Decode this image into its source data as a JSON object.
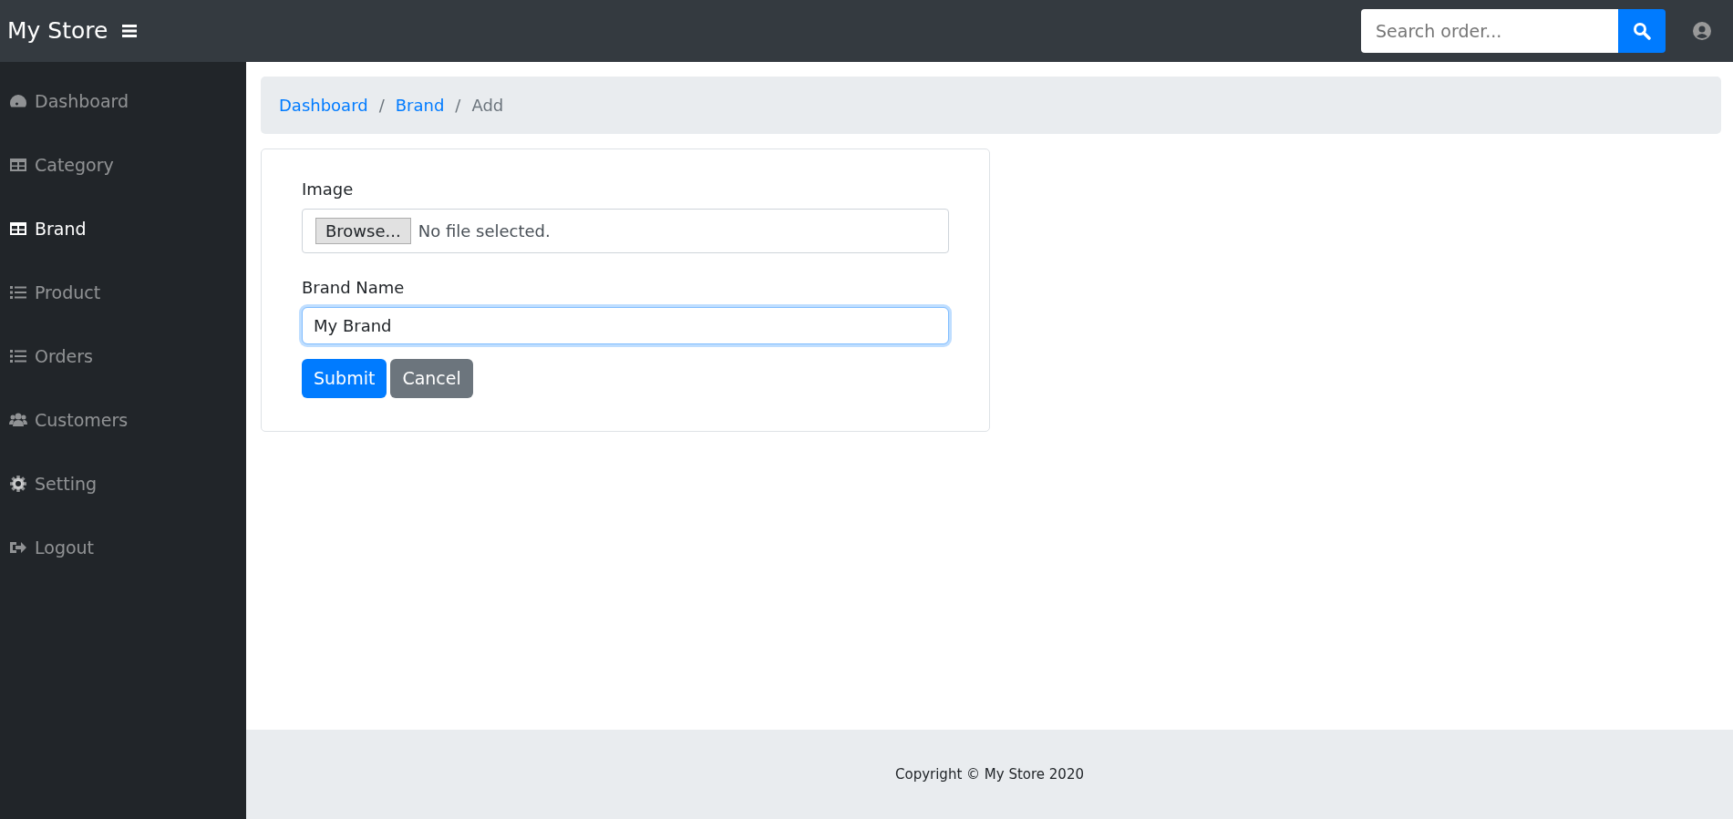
{
  "brand": "My Store",
  "search": {
    "placeholder": "Search order..."
  },
  "sidebar": {
    "items": [
      {
        "label": "Dashboard",
        "selected": false
      },
      {
        "label": "Category",
        "selected": false
      },
      {
        "label": "Brand",
        "selected": true
      },
      {
        "label": "Product",
        "selected": false
      },
      {
        "label": "Orders",
        "selected": false
      },
      {
        "label": "Customers",
        "selected": false
      },
      {
        "label": "Setting",
        "selected": false
      },
      {
        "label": "Logout",
        "selected": false
      }
    ]
  },
  "breadcrumb": [
    {
      "label": "Dashboard",
      "kind": "link"
    },
    {
      "separator": "/",
      "label": "Brand",
      "kind": "link"
    },
    {
      "separator": "/",
      "label": "Add",
      "kind": "current"
    }
  ],
  "form": {
    "image_label": "Image",
    "file_button": "Browse...",
    "file_status": "No file selected.",
    "name_label": "Brand Name",
    "name_value": "My Brand",
    "submit": "Submit",
    "cancel": "Cancel"
  },
  "footer": "Copyright © My Store 2020"
}
